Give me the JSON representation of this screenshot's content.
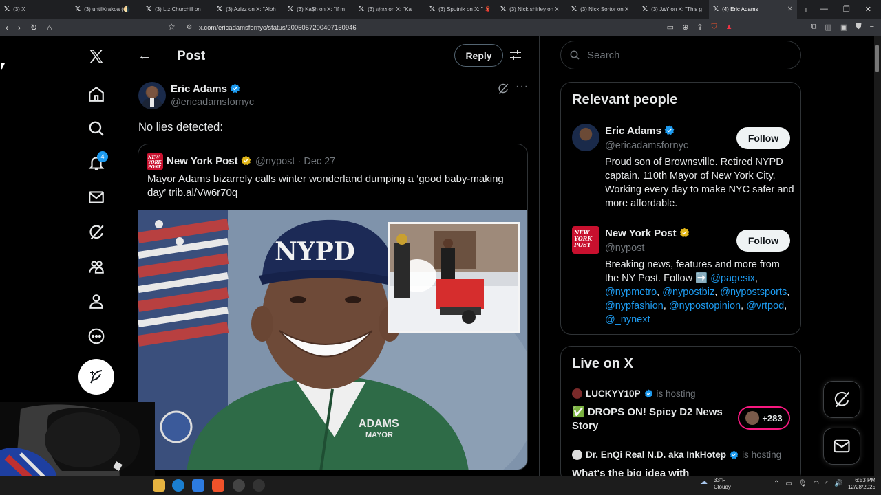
{
  "browser": {
    "tabs": [
      {
        "label": "(3) X"
      },
      {
        "label": "(3) untilKrakoa (🌗"
      },
      {
        "label": "(3) Liz Churchill on"
      },
      {
        "label": "(3) Azizz on X: \"Aloh"
      },
      {
        "label": "(3) Ka$h on X: \"If m"
      },
      {
        "label": "(3) 𝔲𝔣𝔠𝔨𝔞 on X: \"Ka"
      },
      {
        "label": "(3) Sputnik on X: \" 🧣"
      },
      {
        "label": "(3) Nick shirley on X"
      },
      {
        "label": "(3) Nick Sortor on X"
      },
      {
        "label": "(3) J∆Y on X: \"This g"
      },
      {
        "label": "(4) Eric Adams"
      }
    ],
    "url": "x.com/ericadamsfornyc/status/2005057200407150946"
  },
  "nav": {
    "notifications_badge": "4"
  },
  "main": {
    "header_title": "Post",
    "reply_label": "Reply",
    "post": {
      "author_name": "Eric Adams",
      "author_handle": "@ericadamsfornyc",
      "text": "No lies detected:",
      "quote": {
        "author_name": "New York Post",
        "author_handle": "@nypost",
        "date": "Dec 27",
        "text": "Mayor Adams bizarrely calls winter wonderland dumping a ‘good baby-making day’ trib.al/Vw6r70q",
        "logo_text": "NEW YORK POST",
        "image_cap_text": "NYPD",
        "image_jacket_text": "ADAMS",
        "image_jacket_subtext": "MAYOR"
      }
    }
  },
  "sidebar": {
    "search_placeholder": "Search",
    "relevant_title": "Relevant people",
    "people": [
      {
        "name": "Eric Adams",
        "handle": "@ericadamsfornyc",
        "follow_label": "Follow",
        "bio": "Proud son of Brownsville. Retired NYPD captain. 110th Mayor of New York City. Working every day to make NYC safer and more affordable."
      },
      {
        "name": "New York Post",
        "handle": "@nypost",
        "follow_label": "Follow",
        "bio_prefix": "Breaking news, features and more from the NY Post. Follow ➡️ ",
        "bio_links": [
          "@pagesix",
          "@nypmetro",
          "@nypostbiz",
          "@nypostsports",
          "@nypfashion",
          "@nypostopinion",
          "@vrtpod",
          "@_nynext"
        ],
        "logo_text": "NEW YORK POST"
      }
    ],
    "live_title": "Live on X",
    "spaces": [
      {
        "host": "LUCKYY10P",
        "status": "is hosting",
        "title": "✅ DROPS ON! Spicy D2 News Story",
        "listeners": "+283"
      },
      {
        "host": "Dr. EnQi Real N.D. aka InkHotep",
        "status": "is hosting",
        "title": "What's the big idea with"
      }
    ]
  },
  "taskbar": {
    "weather_temp": "33°F",
    "weather_desc": "Cloudy",
    "time": "6:53 PM",
    "date": "12/28/2025"
  },
  "colors": {
    "accent": "#1d9bf0",
    "background": "#000000",
    "border": "#2f3336",
    "muted": "#71767b",
    "nypost_red": "#c8102e",
    "live_pink": "#f91880"
  }
}
